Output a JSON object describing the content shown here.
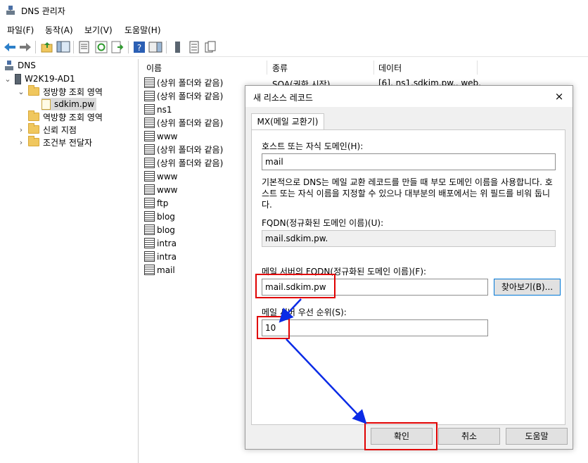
{
  "window": {
    "title": "DNS 관리자",
    "icon": "dns-manager-icon"
  },
  "menu": [
    "파일(F)",
    "동작(A)",
    "보기(V)",
    "도움말(H)"
  ],
  "tree": {
    "root": "DNS",
    "server": "W2K19-AD1",
    "forward_zones": "정방향 조회 영역",
    "zone": "sdkim.pw",
    "reverse_zones": "역방향 조회 영역",
    "trust_points": "신뢰 지점",
    "conditional_forwarders": "조건부 전달자"
  },
  "list": {
    "columns": [
      "이름",
      "종류",
      "데이터"
    ],
    "first_row": {
      "type": "SOA(권한 시작)",
      "data": "[6], ns1.sdkim.pw., web."
    },
    "names": [
      "(상위 폴더와 같음)",
      "(상위 폴더와 같음)",
      "ns1",
      "(상위 폴더와 같음)",
      "www",
      "(상위 폴더와 같음)",
      "(상위 폴더와 같음)",
      "www",
      "www",
      "ftp",
      "blog",
      "blog",
      "intra",
      "intra",
      "mail"
    ]
  },
  "dialog": {
    "title": "새 리소스 레코드",
    "close": "×",
    "tab": "MX(메일 교환기)",
    "host_label": "호스트 또는 자식 도메인(H):",
    "host_value": "mail",
    "description": "기본적으로 DNS는 메일 교환 레코드를 만들 때 부모 도메인 이름을 사용합니다. 호스트 또는 자식 이름을 지정할 수 있으나 대부분의 배포에서는 위 필드를 비워 둡니다.",
    "fqdn_label": "FQDN(정규화된 도메인 이름)(U):",
    "fqdn_value": "mail.sdkim.pw.",
    "mail_server_label": "메일 서버의 FQDN(정규화된 도메인 이름)(F):",
    "mail_server_value": "mail.sdkim.pw",
    "browse_button": "찾아보기(B)...",
    "priority_label": "메일 서버 우선 순위(S):",
    "priority_value": "10",
    "ok_button": "확인",
    "cancel_button": "취소",
    "help_button": "도움말"
  },
  "annotations": {
    "highlight_color": "#e00000",
    "arrow_color": "#0a2be6"
  }
}
